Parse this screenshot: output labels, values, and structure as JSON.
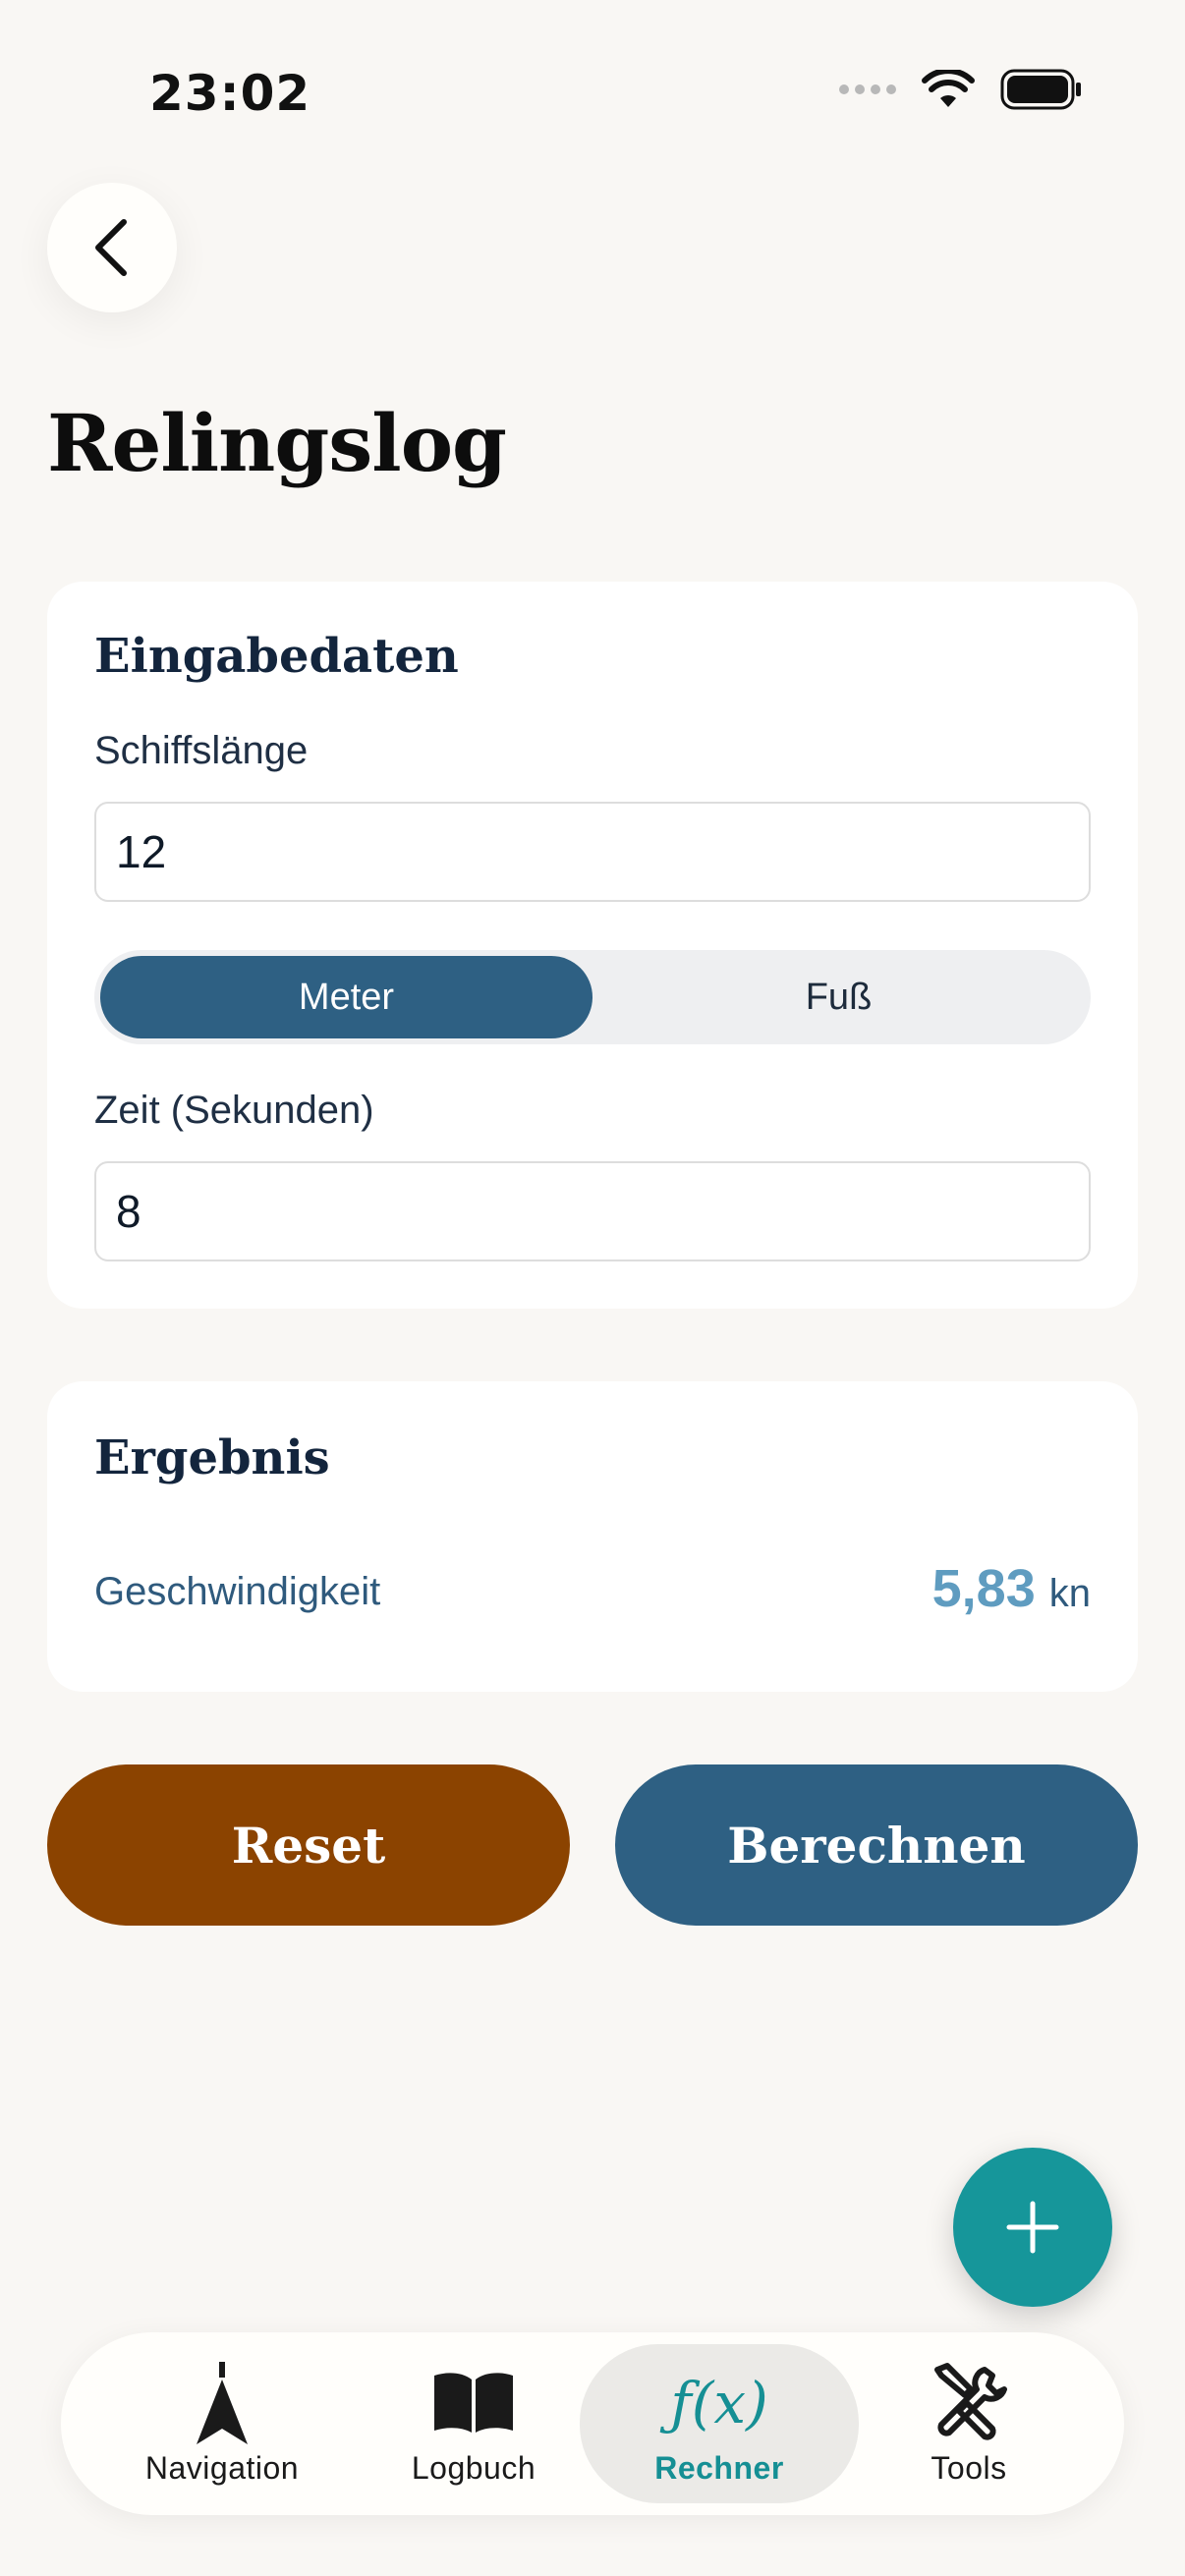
{
  "status_bar": {
    "time": "23:02"
  },
  "header": {
    "title": "Relingslog"
  },
  "input_card": {
    "heading": "Eingabedaten",
    "ship_length_label": "Schiffslänge",
    "ship_length_value": "12",
    "unit_options": [
      "Meter",
      "Fuß"
    ],
    "selected_unit": "Meter",
    "time_label": "Zeit (Sekunden)",
    "time_value": "8"
  },
  "result_card": {
    "heading": "Ergebnis",
    "speed_label": "Geschwindigkeit",
    "speed_value": "5,83",
    "speed_unit": "kn"
  },
  "actions": {
    "reset_label": "Reset",
    "calculate_label": "Berechnen"
  },
  "tabs": [
    {
      "label": "Navigation",
      "icon": "navigation-arrow-icon"
    },
    {
      "label": "Logbuch",
      "icon": "book-icon"
    },
    {
      "label": "Rechner",
      "icon": "fx-icon",
      "glyph": "ƒ(x)"
    },
    {
      "label": "Tools",
      "icon": "tools-icon"
    }
  ],
  "active_tab": "Rechner",
  "colors": {
    "primary": "#2e6083",
    "reset": "#8b4300",
    "accent_teal": "#16969a",
    "result_value": "#5f9cc0",
    "background": "#f9f7f4"
  }
}
